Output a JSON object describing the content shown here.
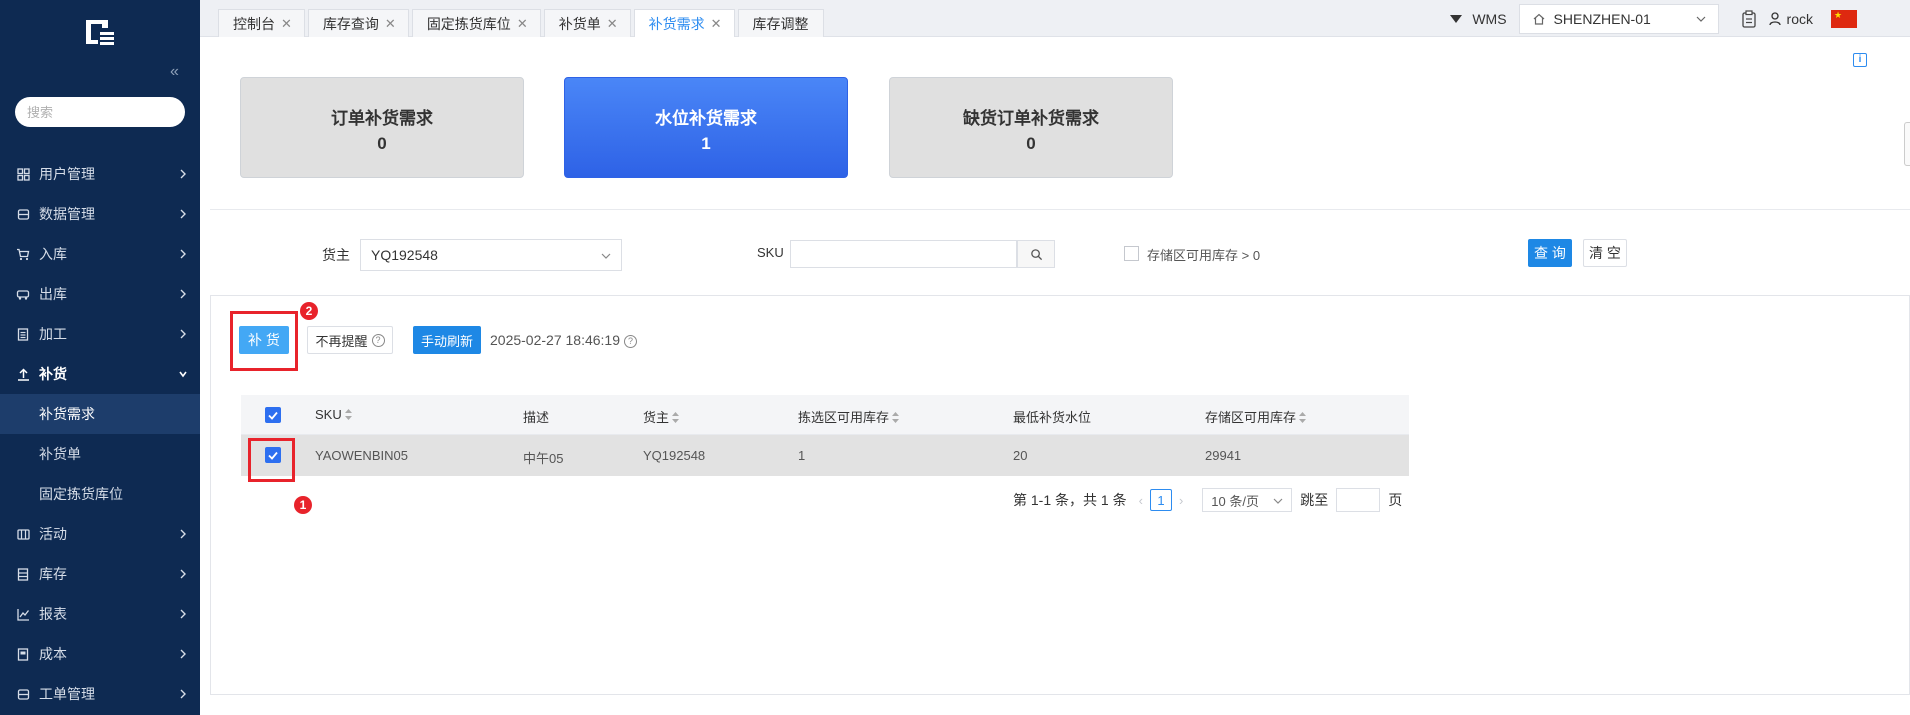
{
  "sidebar": {
    "search_placeholder": "搜索",
    "menu": [
      {
        "label": "用户管理",
        "icon": "users-icon"
      },
      {
        "label": "数据管理",
        "icon": "database-icon"
      },
      {
        "label": "入库",
        "icon": "cart-icon"
      },
      {
        "label": "出库",
        "icon": "truck-icon"
      },
      {
        "label": "加工",
        "icon": "document-icon"
      },
      {
        "label": "补货",
        "icon": "upload-icon"
      }
    ],
    "submenu": [
      {
        "label": "补货需求"
      },
      {
        "label": "补货单"
      },
      {
        "label": "固定拣货库位"
      }
    ],
    "menu_bottom": [
      {
        "label": "活动",
        "icon": "grid-icon"
      },
      {
        "label": "库存",
        "icon": "list-icon"
      },
      {
        "label": "报表",
        "icon": "chart-icon"
      },
      {
        "label": "成本",
        "icon": "book-icon"
      },
      {
        "label": "工单管理",
        "icon": "box-icon"
      }
    ]
  },
  "tabs": [
    {
      "label": "控制台"
    },
    {
      "label": "库存查询"
    },
    {
      "label": "固定拣货库位"
    },
    {
      "label": "补货单"
    },
    {
      "label": "补货需求",
      "active": true
    },
    {
      "label": "库存调整"
    }
  ],
  "topbar": {
    "system": "WMS",
    "warehouse": "SHENZHEN-01",
    "user": "rock"
  },
  "cards": [
    {
      "title": "订单补货需求",
      "value": "0"
    },
    {
      "title": "水位补货需求",
      "value": "1",
      "active": true
    },
    {
      "title": "缺货订单补货需求",
      "value": "0"
    }
  ],
  "filters": {
    "owner_label": "货主",
    "owner_value": "YQ192548",
    "sku_label": "SKU",
    "sku_value": "",
    "stock_filter_label": "存储区可用库存 > 0",
    "query_label": "查 询",
    "clear_label": "清 空"
  },
  "actions": {
    "replenish_label": "补 货",
    "no_remind_label": "不再提醒",
    "refresh_label": "手动刷新",
    "refresh_time": "2025-02-27 18:46:19"
  },
  "table": {
    "headers": [
      "SKU",
      "描述",
      "货主",
      "拣选区可用库存",
      "最低补货水位",
      "存储区可用库存"
    ],
    "rows": [
      {
        "sku": "YAOWENBIN05",
        "desc": "中午05",
        "owner": "YQ192548",
        "pick_stock": "1",
        "min_level": "20",
        "storage_stock": "29941"
      }
    ]
  },
  "pagination": {
    "summary": "第 1-1 条，共 1 条",
    "current": "1",
    "page_size": "10 条/页",
    "jump_label": "跳至",
    "page_suffix": "页"
  },
  "annotations": {
    "badge_1": "1",
    "badge_2": "2"
  },
  "colors": {
    "sidebar_bg": "#0e2a52",
    "primary": "#1e88e5",
    "highlight": "#e8232b",
    "active_card": "#2e62e6"
  }
}
